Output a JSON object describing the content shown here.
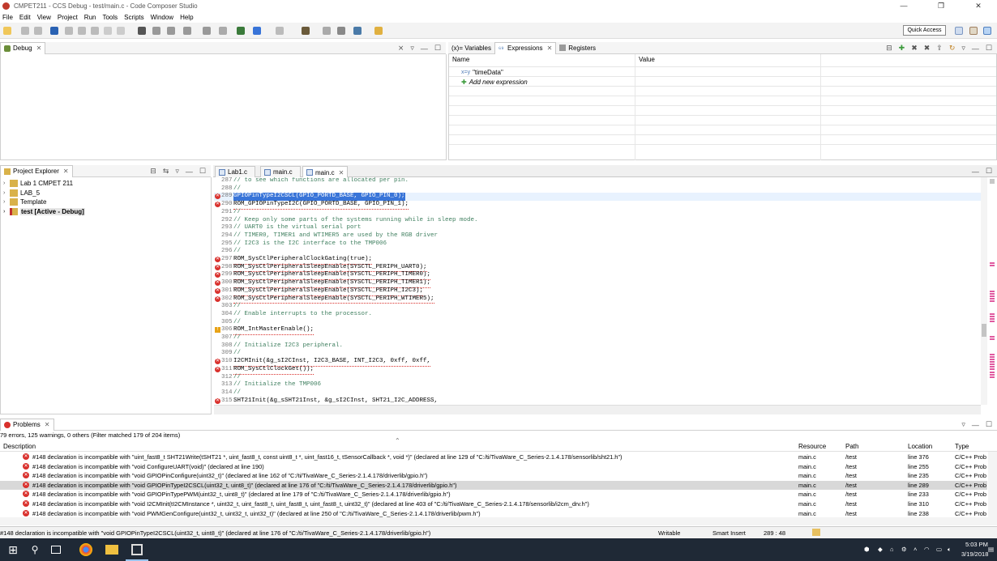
{
  "window": {
    "title": "CMPET211 - CCS Debug - test/main.c - Code Composer Studio",
    "controls": [
      "—",
      "❐",
      "✕"
    ]
  },
  "menu": [
    "File",
    "Edit",
    "View",
    "Project",
    "Run",
    "Tools",
    "Scripts",
    "Window",
    "Help"
  ],
  "toolbar": {
    "quick_access": "Quick Access"
  },
  "debug_panel": {
    "tab": "Debug"
  },
  "expressions_panel": {
    "tabs": [
      "(x)= Variables",
      "Expressions",
      "Registers"
    ],
    "columns": [
      "Name",
      "Value"
    ],
    "rows": [
      {
        "name": "\"timeData\"",
        "icon": "expression-icon"
      },
      {
        "name": "Add new expression",
        "icon": "add-icon"
      }
    ]
  },
  "project_explorer": {
    "tab": "Project Explorer",
    "items": [
      {
        "label": "Lab 1 CMPET 211",
        "bold": false
      },
      {
        "label": "LAB_5",
        "bold": false
      },
      {
        "label": "Template",
        "bold": false
      },
      {
        "label": "test  [Active - Debug]",
        "bold": true
      }
    ]
  },
  "editor": {
    "tabs": [
      "Lab1.c",
      "main.c",
      "main.c"
    ],
    "active_tab": 2,
    "lines": [
      {
        "n": "287",
        "text": "// to see which functions are allocated per pin.",
        "type": "comment",
        "marker": ""
      },
      {
        "n": "288",
        "text": "//",
        "type": "comment",
        "marker": ""
      },
      {
        "n": "289",
        "text": "GPIOPinTypeI2CSCL(GPIO_PORTD_BASE, GPIO_PIN_0);",
        "type": "selected",
        "marker": "error"
      },
      {
        "n": "290",
        "text": "ROM_GPIOPinTypeI2C(GPIO_PORTD_BASE, GPIO_PIN_1);",
        "type": "error",
        "marker": "error"
      },
      {
        "n": "291",
        "text": "//",
        "type": "comment",
        "marker": ""
      },
      {
        "n": "292",
        "text": "// Keep only some parts of the systems running while in sleep mode.",
        "type": "comment",
        "marker": ""
      },
      {
        "n": "293",
        "text": "// UART0 is the virtual serial port",
        "type": "comment",
        "marker": ""
      },
      {
        "n": "294",
        "text": "// TIMER0, TIMER1 and WTIMER5 are used by the RGB driver",
        "type": "comment",
        "marker": ""
      },
      {
        "n": "295",
        "text": "// I2C3 is the I2C interface to the TMP006",
        "type": "comment",
        "marker": ""
      },
      {
        "n": "296",
        "text": "//",
        "type": "comment",
        "marker": ""
      },
      {
        "n": "297",
        "text": "ROM_SysCtlPeripheralClockGating(true);",
        "type": "error",
        "marker": "error"
      },
      {
        "n": "298",
        "text": "ROM_SysCtlPeripheralSleepEnable(SYSCTL_PERIPH_UART0);",
        "type": "error",
        "marker": "error"
      },
      {
        "n": "299",
        "text": "ROM_SysCtlPeripheralSleepEnable(SYSCTL_PERIPH_TIMER0);",
        "type": "error",
        "marker": "error"
      },
      {
        "n": "300",
        "text": "ROM_SysCtlPeripheralSleepEnable(SYSCTL_PERIPH_TIMER1);",
        "type": "error",
        "marker": "error"
      },
      {
        "n": "301",
        "text": "ROM_SysCtlPeripheralSleepEnable(SYSCTL_PERIPH_I2C3);",
        "type": "error",
        "marker": "error"
      },
      {
        "n": "302",
        "text": "ROM_SysCtlPeripheralSleepEnable(SYSCTL_PERIPH_WTIMER5);",
        "type": "error",
        "marker": "error"
      },
      {
        "n": "303",
        "text": "//",
        "type": "comment",
        "marker": ""
      },
      {
        "n": "304",
        "text": "// Enable interrupts to the processor.",
        "type": "comment",
        "marker": ""
      },
      {
        "n": "305",
        "text": "//",
        "type": "comment",
        "marker": ""
      },
      {
        "n": "306",
        "text": "ROM_IntMasterEnable();",
        "type": "error",
        "marker": "warning"
      },
      {
        "n": "307",
        "text": "//",
        "type": "comment",
        "marker": ""
      },
      {
        "n": "308",
        "text": "// Initialize I2C3 peripheral.",
        "type": "comment",
        "marker": ""
      },
      {
        "n": "309",
        "text": "//",
        "type": "comment",
        "marker": ""
      },
      {
        "n": "310",
        "text": "I2CMInit(&g_sI2CInst, I2C3_BASE, INT_I2C3, 0xff, 0xff,",
        "type": "error",
        "marker": "error"
      },
      {
        "n": "311",
        "text": "ROM_SysCtlClockGet());",
        "type": "error",
        "marker": "error"
      },
      {
        "n": "312",
        "text": "//",
        "type": "comment",
        "marker": ""
      },
      {
        "n": "313",
        "text": "// Initialize the TMP006",
        "type": "comment",
        "marker": ""
      },
      {
        "n": "314",
        "text": "//",
        "type": "comment",
        "marker": ""
      },
      {
        "n": "315",
        "text": "SHT21Init(&g_sSHT21Inst, &g_sI2CInst, SHT21_I2C_ADDRESS,",
        "type": "error",
        "marker": "error"
      }
    ]
  },
  "problems": {
    "tab": "Problems",
    "summary": "79 errors, 125 warnings, 0 others (Filter matched 179 of 204 items)",
    "columns": [
      "Description",
      "Resource",
      "Path",
      "Location",
      "Type"
    ],
    "rows": [
      {
        "desc": "#148 declaration is incompatible with \"uint_fast8_t SHT21Write(tSHT21 *, uint_fast8_t, const uint8_t *, uint_fast16_t, tSensorCallback *, void *)\" (declared at line 129 of \"C:/ti/TivaWare_C_Series-2.1.4.178/sensorlib/sht21.h\")",
        "resource": "main.c",
        "path": "/test",
        "location": "line 376",
        "type": "C/C++ Prob"
      },
      {
        "desc": "#148 declaration is incompatible with \"void ConfigureUART(void)\" (declared at line 190)",
        "resource": "main.c",
        "path": "/test",
        "location": "line 255",
        "type": "C/C++ Prob"
      },
      {
        "desc": "#148 declaration is incompatible with \"void GPIOPinConfigure(uint32_t)\" (declared at line 162 of \"C:/ti/TivaWare_C_Series-2.1.4.178/driverlib/gpio.h\")",
        "resource": "main.c",
        "path": "/test",
        "location": "line 235",
        "type": "C/C++ Prob"
      },
      {
        "desc": "#148 declaration is incompatible with \"void GPIOPinTypeI2CSCL(uint32_t, uint8_t)\" (declared at line 176 of \"C:/ti/TivaWare_C_Series-2.1.4.178/driverlib/gpio.h\")",
        "resource": "main.c",
        "path": "/test",
        "location": "line 289",
        "type": "C/C++ Prob"
      },
      {
        "desc": "#148 declaration is incompatible with \"void GPIOPinTypePWM(uint32_t, uint8_t)\" (declared at line 179 of \"C:/ti/TivaWare_C_Series-2.1.4.178/driverlib/gpio.h\")",
        "resource": "main.c",
        "path": "/test",
        "location": "line 233",
        "type": "C/C++ Prob"
      },
      {
        "desc": "#148 declaration is incompatible with \"void I2CMInit(tI2CMInstance *, uint32_t, uint_fast8_t, uint_fast8_t, uint_fast8_t, uint32_t)\" (declared at line 403 of \"C:/ti/TivaWare_C_Series-2.1.4.178/sensorlib/i2cm_drv.h\")",
        "resource": "main.c",
        "path": "/test",
        "location": "line 310",
        "type": "C/C++ Prob"
      },
      {
        "desc": "#148 declaration is incompatible with \"void PWMGenConfigure(uint32_t, uint32_t, uint32_t)\" (declared at line 250 of \"C:/ti/TivaWare_C_Series-2.1.4.178/driverlib/pwm.h\")",
        "resource": "main.c",
        "path": "/test",
        "location": "line 238",
        "type": "C/C++ Prob"
      }
    ],
    "selected_row": 3
  },
  "status": {
    "message": "#148 declaration is incompatible with \"void GPIOPinTypeI2CSCL(uint32_t, uint8_t)\" (declared at line 176 of \"C:/ti/TivaWare_C_Series-2.1.4.178/driverlib/gpio.h\")",
    "mode": "Writable",
    "insert": "Smart Insert",
    "position": "289 : 48"
  },
  "taskbar": {
    "time": "5:03 PM",
    "date": "3/19/2018"
  },
  "colors": {
    "error": "#d9302c",
    "selection": "#3874d8",
    "comment": "#3f7f5f",
    "taskbar": "#1f2936"
  }
}
